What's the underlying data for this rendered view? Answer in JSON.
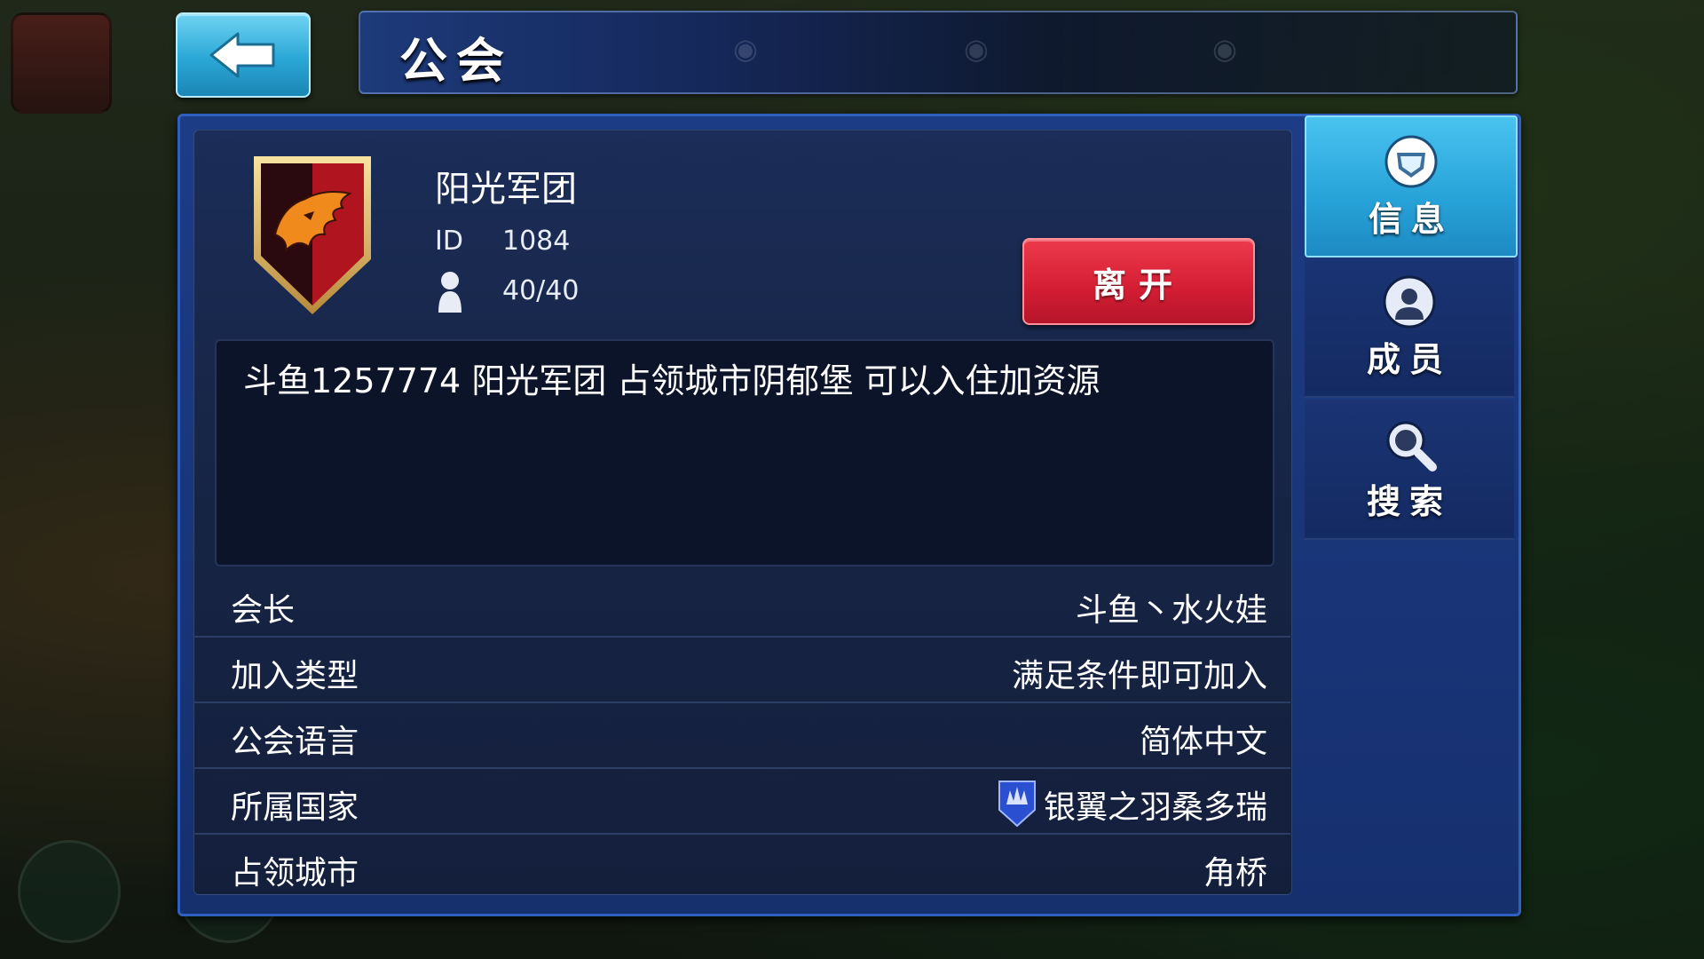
{
  "header": {
    "title": "公会"
  },
  "guild": {
    "name": "阳光军团",
    "id_label": "ID",
    "id_value": "1084",
    "members": "40/40",
    "leave_label": "离开",
    "notice": "斗鱼1257774  阳光军团  占领城市阴郁堡 可以入住加资源"
  },
  "info_rows": [
    {
      "label": "会长",
      "value": "斗鱼丶水火娃"
    },
    {
      "label": "加入类型",
      "value": "满足条件即可加入"
    },
    {
      "label": "公会语言",
      "value": "简体中文"
    },
    {
      "label": "所属国家",
      "value": "银翼之羽桑多瑞"
    },
    {
      "label": "占领城市",
      "value": "角桥"
    }
  ],
  "tabs": [
    {
      "label": "信息",
      "icon": "info-shield-icon",
      "active": true
    },
    {
      "label": "成员",
      "icon": "member-icon",
      "active": false
    },
    {
      "label": "搜索",
      "icon": "search-icon",
      "active": false
    }
  ],
  "colors": {
    "panel_blue": "#1d3c86",
    "tab_active": "#27a2d8",
    "leave_red": "#d31d33",
    "emblem_orange": "#f08a1c"
  }
}
